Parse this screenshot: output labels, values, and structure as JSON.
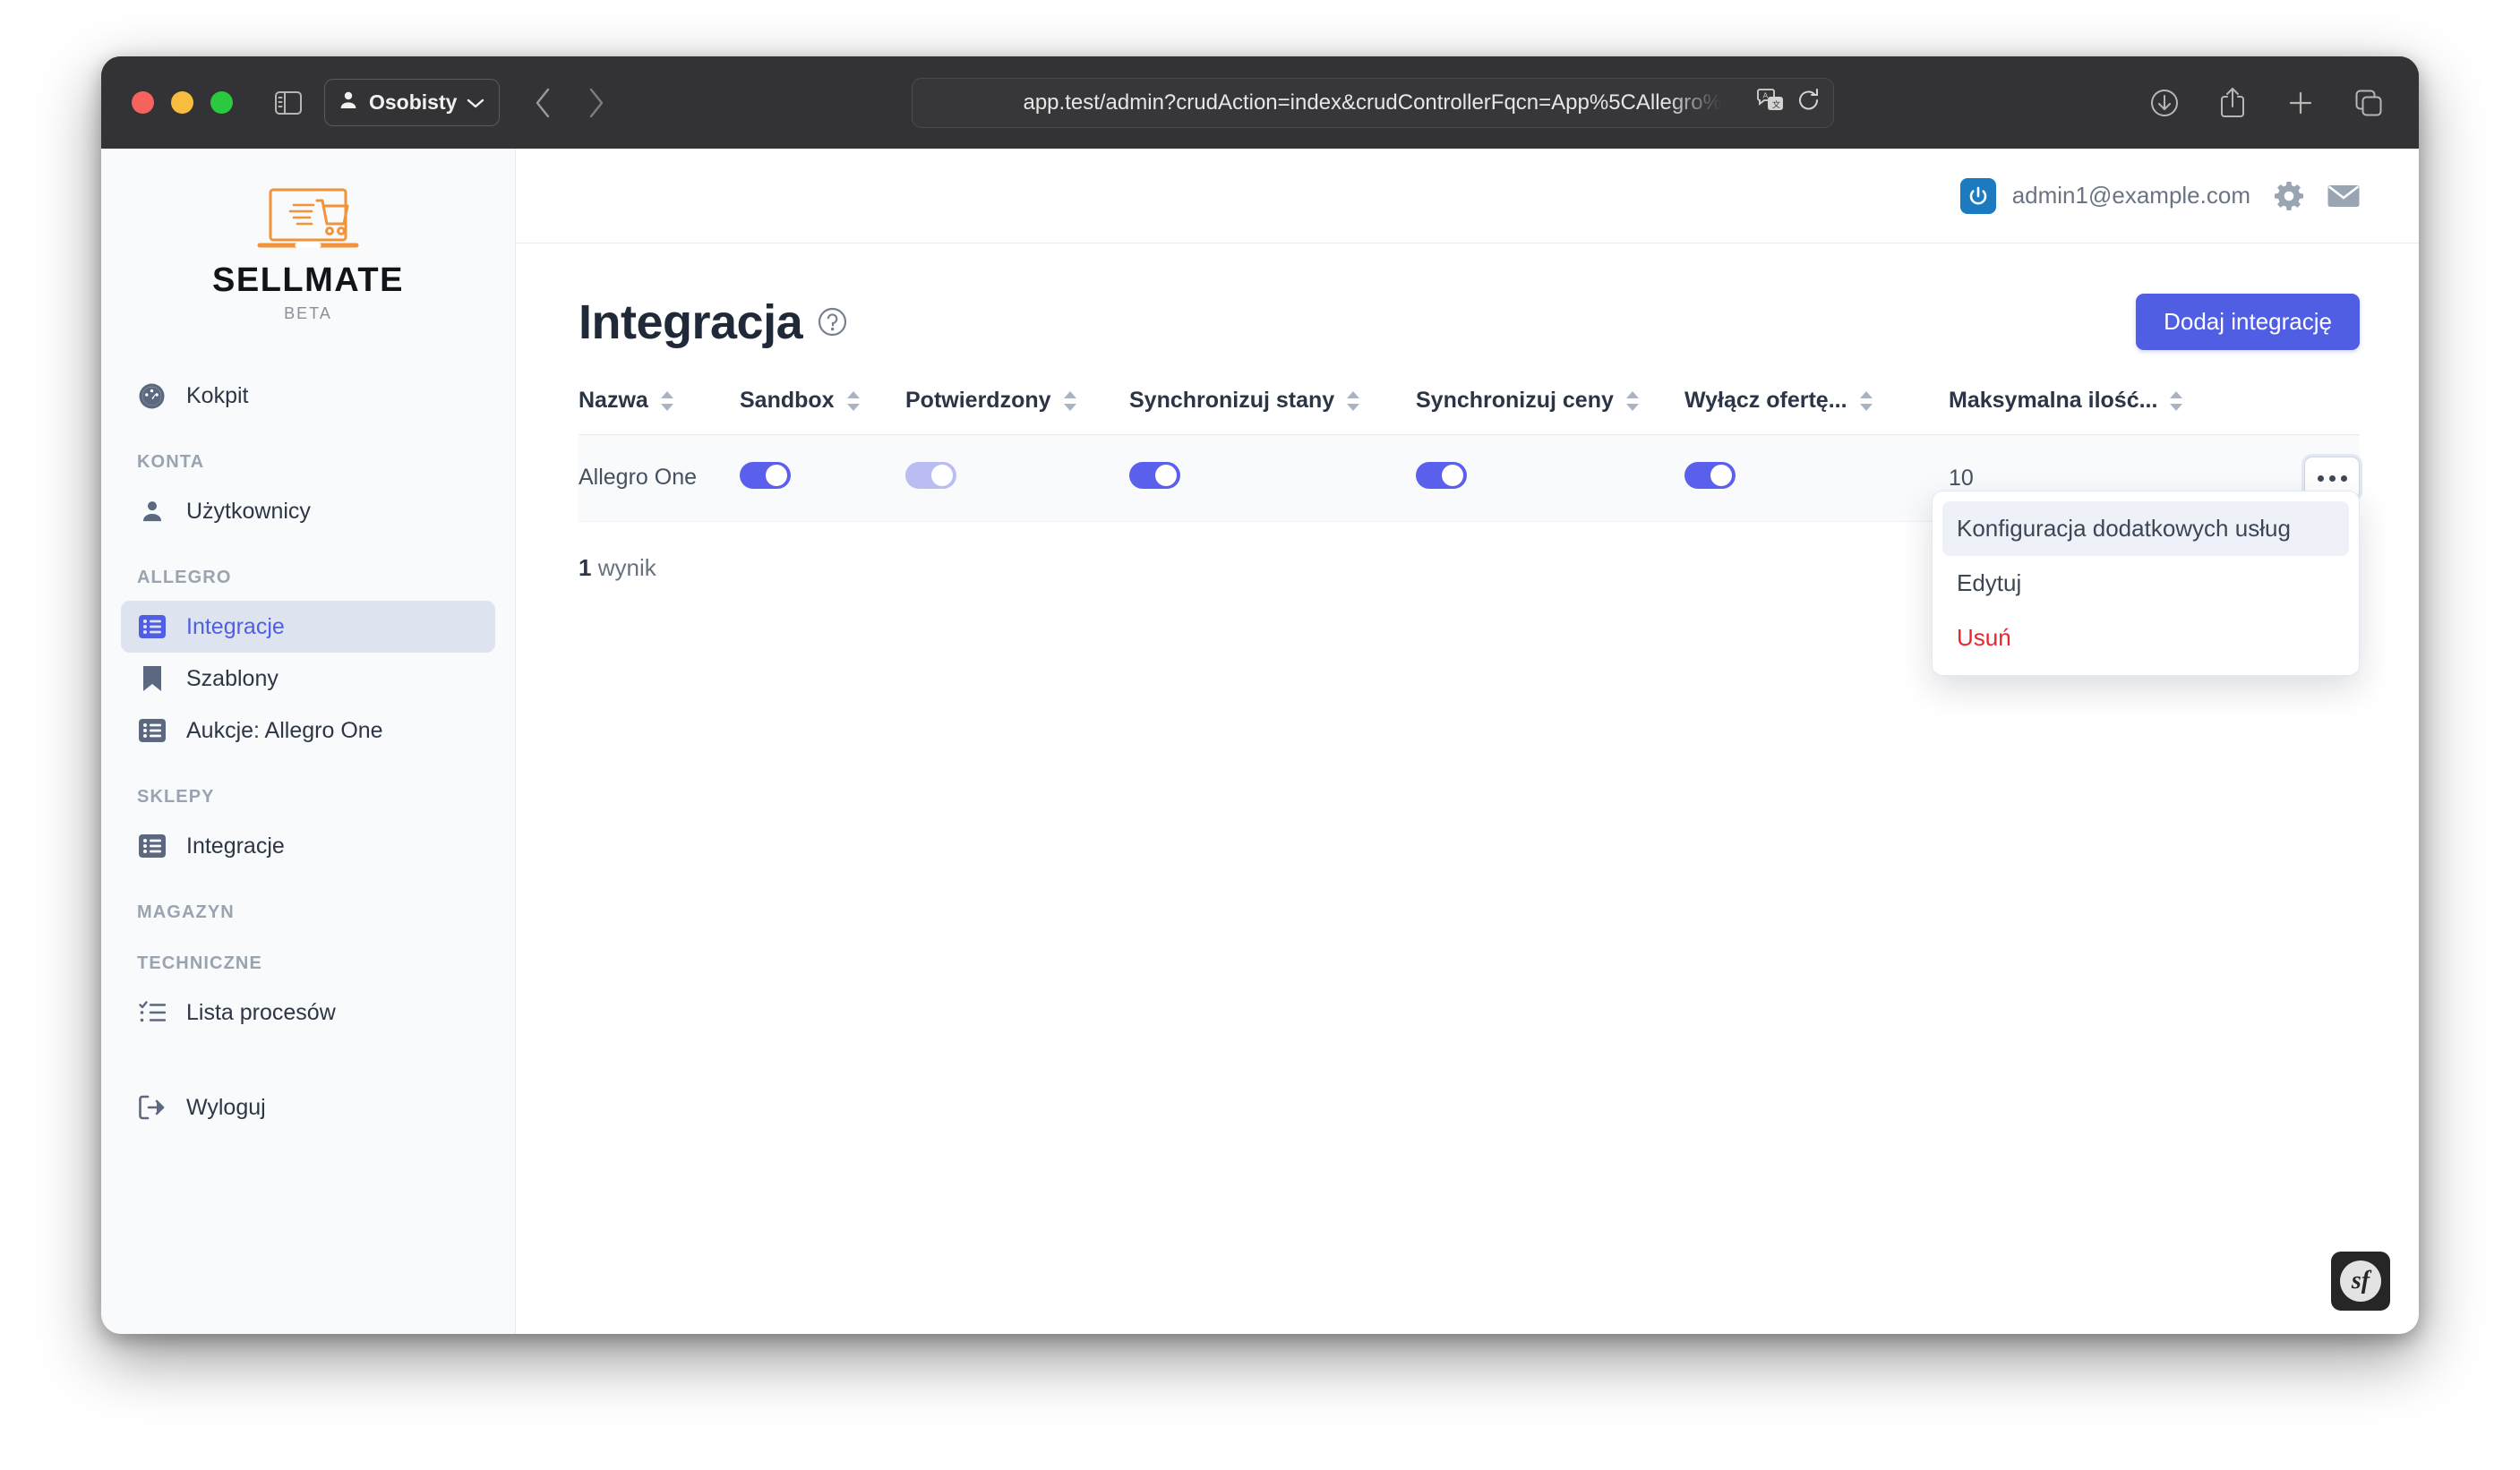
{
  "browser": {
    "profile_label": "Osobisty",
    "url": "app.test/admin?crudAction=index&crudControllerFqcn=App%5CAllegro%",
    "icons": {
      "sidebar_toggle": "sidebar-toggle-icon",
      "back": "back-arrow-icon",
      "forward": "forward-arrow-icon",
      "translate": "translate-icon",
      "reload": "reload-icon",
      "downloads": "downloads-icon",
      "share": "share-icon",
      "new_tab": "plus-icon",
      "tab_overview": "tab-overview-icon"
    }
  },
  "brand": {
    "name": "SELLMATE",
    "tag": "BETA"
  },
  "sidebar": {
    "top_items": [
      {
        "label": "Kokpit",
        "icon": "gauge-icon",
        "active": false
      }
    ],
    "sections": [
      {
        "title": "KONTA",
        "items": [
          {
            "label": "Użytkownicy",
            "icon": "user-icon",
            "active": false
          }
        ]
      },
      {
        "title": "ALLEGRO",
        "items": [
          {
            "label": "Integracje",
            "icon": "list-icon",
            "active": true
          },
          {
            "label": "Szablony",
            "icon": "bookmark-icon",
            "active": false
          },
          {
            "label": "Aukcje: Allegro One",
            "icon": "list-icon",
            "active": false
          }
        ]
      },
      {
        "title": "SKLEPY",
        "items": [
          {
            "label": "Integracje",
            "icon": "list-icon",
            "active": false
          }
        ]
      },
      {
        "title": "MAGAZYN",
        "items": []
      },
      {
        "title": "TECHNICZNE",
        "items": [
          {
            "label": "Lista procesów",
            "icon": "checklist-icon",
            "active": false
          }
        ]
      }
    ],
    "logout": {
      "label": "Wyloguj",
      "icon": "logout-icon"
    }
  },
  "topbar": {
    "user_email": "admin1@example.com",
    "power_icon": "power-icon",
    "settings_icon": "gear-icon",
    "mail_icon": "envelope-icon"
  },
  "page": {
    "title": "Integracja",
    "help_icon": "question-circle-icon",
    "add_button": "Dodaj integrację"
  },
  "table": {
    "columns": [
      {
        "label": "Nazwa",
        "sortable": true
      },
      {
        "label": "Sandbox",
        "sortable": true
      },
      {
        "label": "Potwierdzony",
        "sortable": true
      },
      {
        "label": "Synchronizuj stany",
        "sortable": true
      },
      {
        "label": "Synchronizuj ceny",
        "sortable": true
      },
      {
        "label": "Wyłącz ofertę...",
        "sortable": true
      },
      {
        "label": "Maksymalna ilość...",
        "sortable": true
      },
      {
        "label": "",
        "sortable": false
      }
    ],
    "rows": [
      {
        "name": "Allegro One",
        "sandbox": {
          "on": true,
          "muted": false
        },
        "potwierdzony": {
          "on": true,
          "muted": true
        },
        "synchronizuj_stany": {
          "on": true,
          "muted": false
        },
        "synchronizuj_ceny": {
          "on": true,
          "muted": false
        },
        "wylacz_oferte": {
          "on": true,
          "muted": false
        },
        "maksymalna_ilosc": "10",
        "actions_icon": "ellipsis-icon"
      }
    ],
    "result_count_value": "1",
    "result_count_label": "wynik"
  },
  "dropdown": {
    "items": [
      {
        "label": "Konfiguracja dodatkowych usług",
        "style": "highlight"
      },
      {
        "label": "Edytuj",
        "style": "normal"
      },
      {
        "label": "Usuń",
        "style": "danger"
      }
    ]
  },
  "footer": {
    "symfony_badge": "sf"
  },
  "colors": {
    "accent": "#4f5ee3",
    "toggle_on": "#5b60ec",
    "toggle_muted": "#b9bdf2",
    "danger": "#e8262c",
    "sidebar_bg": "#f8fafc",
    "active_nav_bg": "#dde4ef"
  }
}
